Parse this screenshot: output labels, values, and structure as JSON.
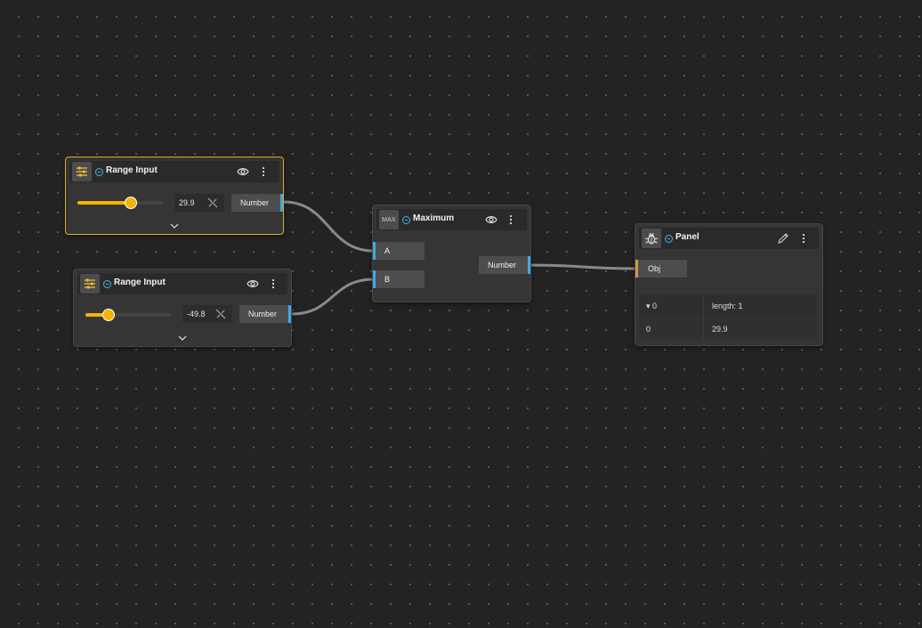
{
  "nodes": {
    "range1": {
      "title": "Range Input",
      "value": "29.9",
      "fraction": 0.62,
      "output_label": "Number",
      "selected": true
    },
    "range2": {
      "title": "Range Input",
      "value": "-49.8",
      "fraction": 0.27,
      "output_label": "Number",
      "selected": false
    },
    "maximum": {
      "icon_text": "MAX",
      "title": "Maximum",
      "input_a": "A",
      "input_b": "B",
      "output_label": "Number"
    },
    "panel": {
      "title": "Panel",
      "input_label": "Obj",
      "rows": [
        {
          "key": "▾ 0",
          "value": "length: 1"
        },
        {
          "key": "0",
          "value": "29.9"
        }
      ]
    }
  },
  "colors": {
    "background": "#232323",
    "accent_slider": "#f5b400",
    "port_number": "#3fa9e8",
    "port_object": "#d19a48",
    "selection": "#d8ad2c"
  },
  "icons": {
    "range_type": "sliders-icon",
    "panel_type": "bug-icon",
    "status": "status-dot-icon",
    "visibility": "eye-icon",
    "more": "more-vertical-icon",
    "edit": "pencil-icon",
    "link": "link-off-icon",
    "expand": "chevron-down-icon"
  }
}
